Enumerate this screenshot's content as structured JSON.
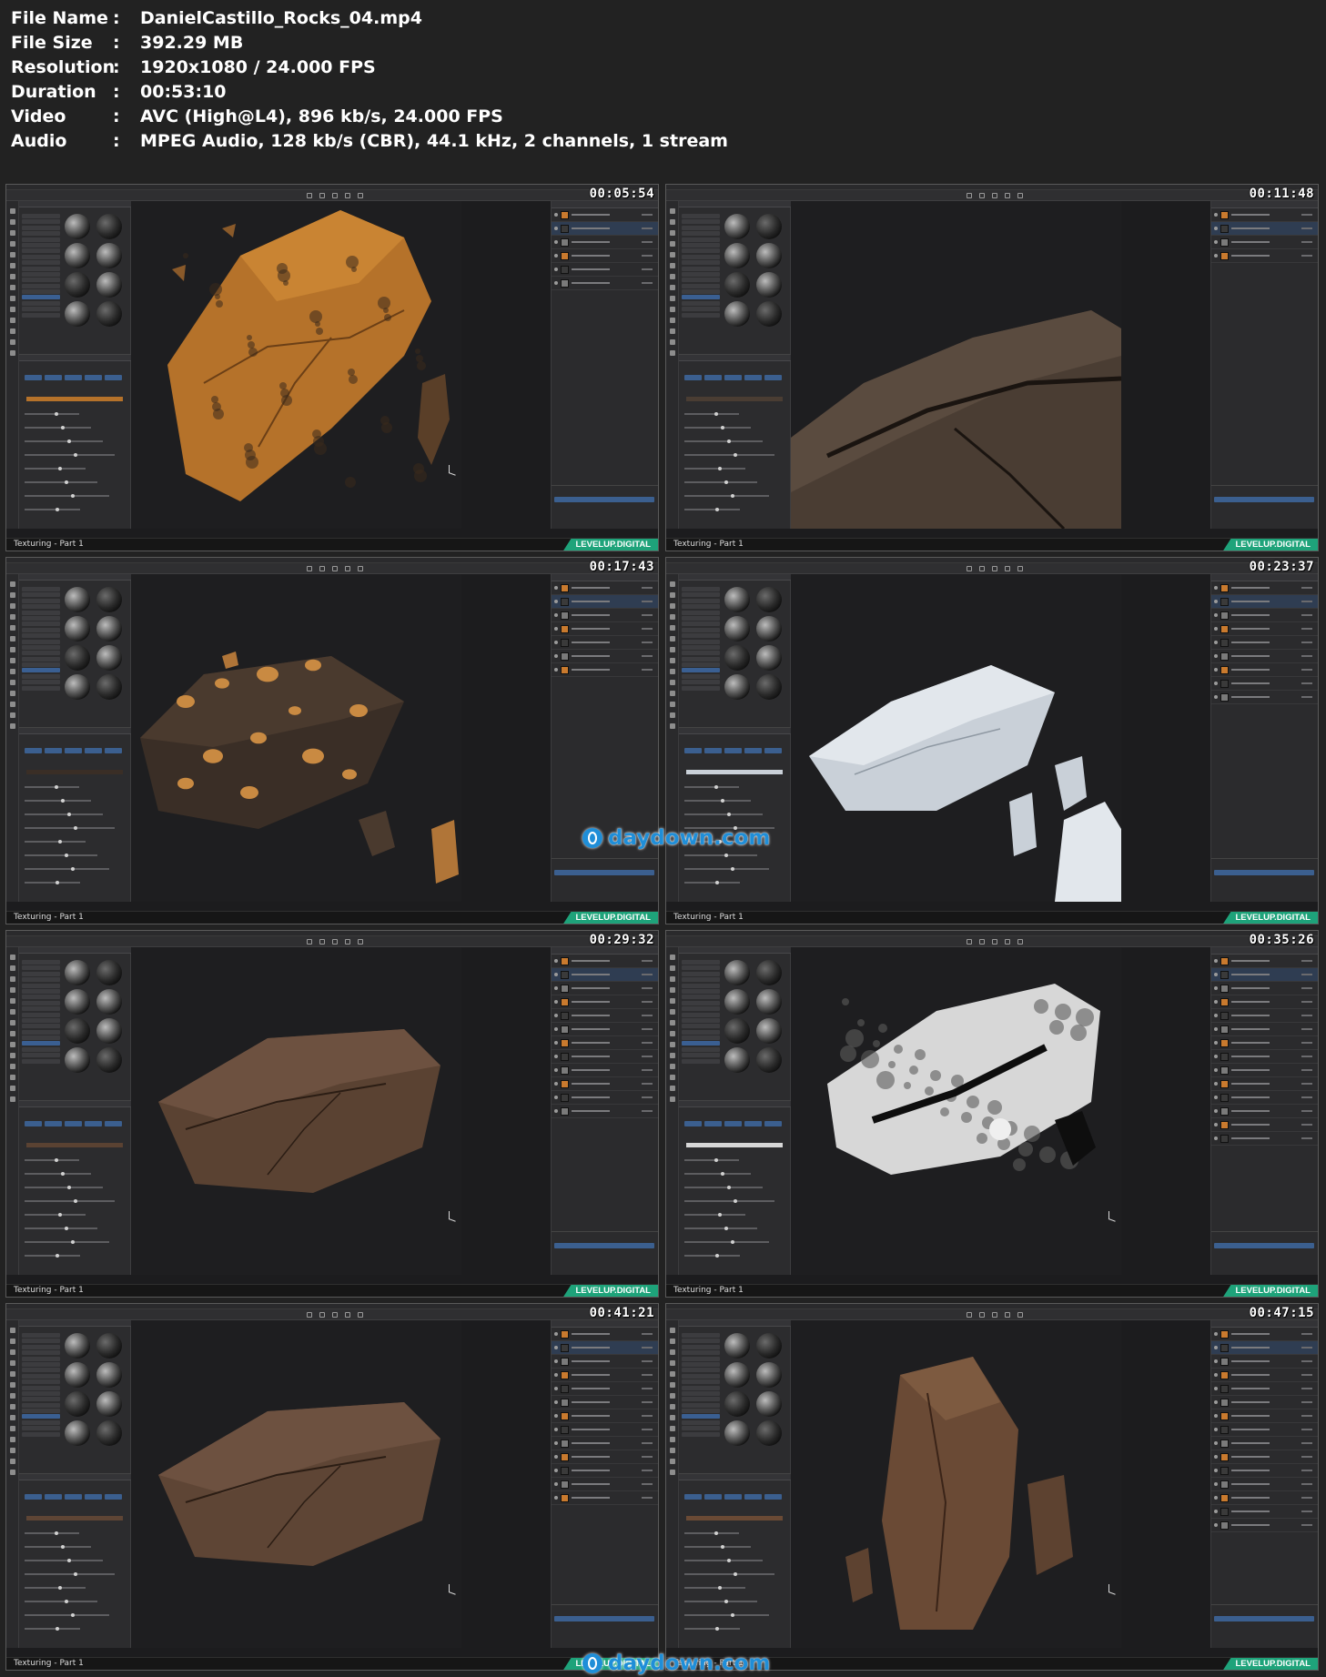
{
  "file_info": [
    {
      "key": "File Name",
      "sep": ":",
      "value": "DanielCastillo_Rocks_04.mp4"
    },
    {
      "key": "File Size",
      "sep": ":",
      "value": "392.29 MB"
    },
    {
      "key": "Resolution",
      "sep": ":",
      "value": "1920x1080 / 24.000 FPS"
    },
    {
      "key": "Duration",
      "sep": ":",
      "value": "00:53:10"
    },
    {
      "key": "Video",
      "sep": ":",
      "value": "AVC (High@L4), 896 kb/s, 24.000 FPS"
    },
    {
      "key": "Audio",
      "sep": ":",
      "value": "MPEG Audio, 128 kb/s (CBR), 44.1 kHz, 2 channels, 1 stream"
    }
  ],
  "thumbnails": [
    {
      "timestamp": "00:05:54",
      "caption": "Texturing - Part 1",
      "brand": "LEVELUP.DIGITAL",
      "rock_color": "#b5722a",
      "rock_style": "orange"
    },
    {
      "timestamp": "00:11:48",
      "caption": "Texturing - Part 1",
      "brand": "LEVELUP.DIGITAL",
      "rock_color": "#4a3d33",
      "rock_style": "closeup"
    },
    {
      "timestamp": "00:17:43",
      "caption": "Texturing - Part 1",
      "brand": "LEVELUP.DIGITAL",
      "rock_color": "#3a2e26",
      "rock_style": "spotted"
    },
    {
      "timestamp": "00:23:37",
      "caption": "Texturing - Part 1",
      "brand": "LEVELUP.DIGITAL",
      "rock_color": "#c9d0d8",
      "rock_style": "white"
    },
    {
      "timestamp": "00:29:32",
      "caption": "Texturing - Part 1",
      "brand": "LEVELUP.DIGITAL",
      "rock_color": "#5a4232",
      "rock_style": "brown"
    },
    {
      "timestamp": "00:35:26",
      "caption": "Texturing - Part 1",
      "brand": "LEVELUP.DIGITAL",
      "rock_color": "#d7d7d7",
      "rock_style": "mask"
    },
    {
      "timestamp": "00:41:21",
      "caption": "Texturing - Part 1",
      "brand": "LEVELUP.DIGITAL",
      "rock_color": "#5e4535",
      "rock_style": "brown"
    },
    {
      "timestamp": "00:47:15",
      "caption": "Texturing - Part 1",
      "brand": "LEVELUP.DIGITAL",
      "rock_color": "#6a4a35",
      "rock_style": "vertical"
    }
  ],
  "watermarks": [
    {
      "text": "daydown.com",
      "icon": "d-logo-icon",
      "color": "#1f8ed8"
    },
    {
      "text": "daydown.com",
      "icon": "d-logo-icon",
      "color": "#1f8ed8"
    }
  ]
}
